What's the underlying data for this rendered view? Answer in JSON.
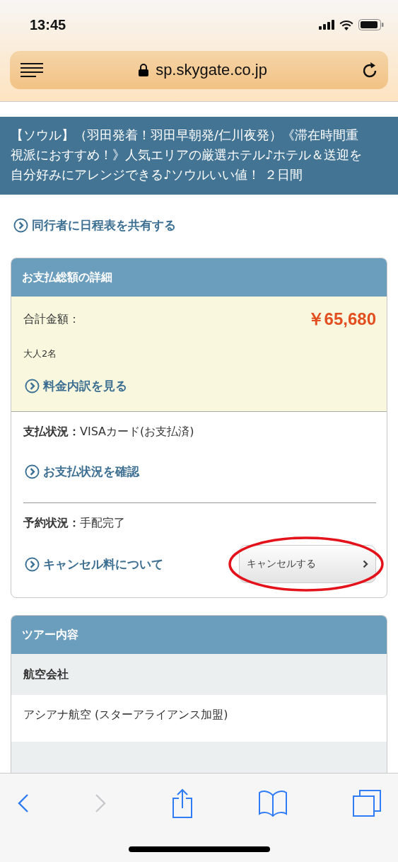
{
  "status_bar": {
    "time": "13:45"
  },
  "address_bar": {
    "url": "sp.skygate.co.jp"
  },
  "tour_title": "【ソウル】（羽田発着！羽田早朝発/仁川夜発）《滞在時間重視派におすすめ！》人気エリアの厳選ホテル♪ホテル＆送迎を自分好みにアレンジできる♪ソウルいい値！ ２日間",
  "share_link": "同行者に日程表を共有する",
  "payment_card": {
    "title": "お支払総額の詳細",
    "total_label": "合計金額：",
    "total_amount": "￥65,680",
    "travelers": "大人2名",
    "breakdown_link": "料金内訳を見る",
    "payment_status": "**支払状況：**VISAカード(お支払済)",
    "payment_link": "お支払状況を確認",
    "booking_status": "**予約状況：**手配完了",
    "cancel_fee_link": "キャンセル料について",
    "cancel_button": "キャンセルする"
  },
  "tour_card": {
    "title": "ツアー内容",
    "rows": [
      {
        "kind": "heading",
        "text": "航空会社"
      },
      {
        "kind": "value",
        "text": "アシアナ航空 (スターアライアンス加盟)"
      },
      {
        "kind": "heading"
      }
    ]
  },
  "toolbar": {
    "buttons": [
      {
        "kind": "back",
        "disabled": false
      },
      {
        "kind": "forward",
        "disabled": true
      },
      {
        "kind": "share",
        "disabled": false
      },
      {
        "kind": "bookmarks",
        "disabled": false
      },
      {
        "kind": "tabs",
        "disabled": false
      }
    ]
  }
}
